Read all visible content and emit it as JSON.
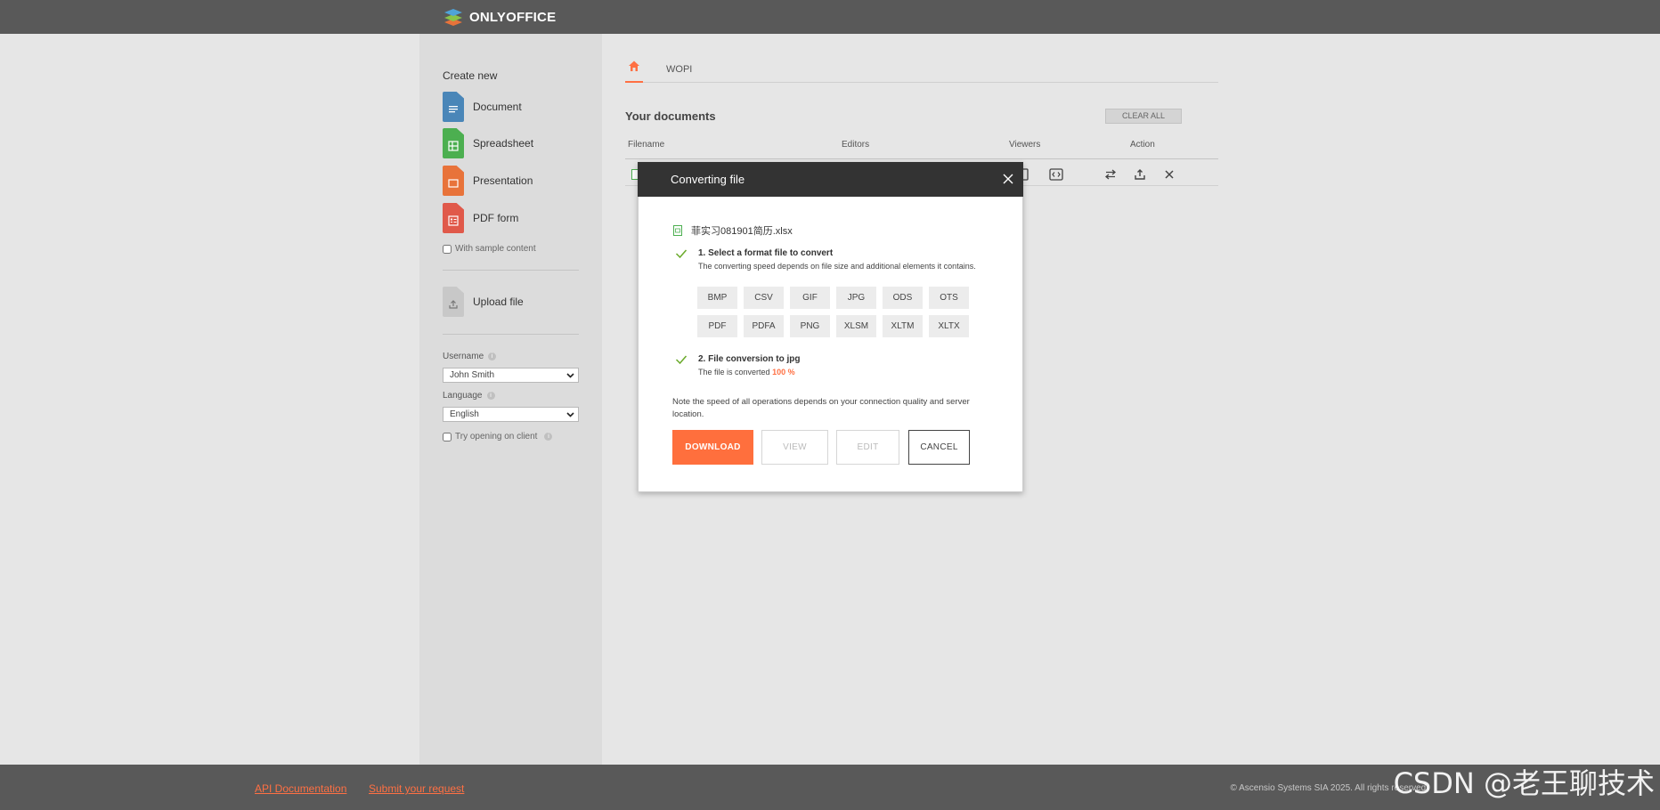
{
  "header": {
    "brand": "ONLYOFFICE"
  },
  "sidebar": {
    "create_title": "Create new",
    "create_items": [
      {
        "label": "Document",
        "color": "#4a86b8"
      },
      {
        "label": "Spreadsheet",
        "color": "#4caf50"
      },
      {
        "label": "Presentation",
        "color": "#e8733a"
      },
      {
        "label": "PDF form",
        "color": "#e0594a"
      }
    ],
    "sample_content_label": "With sample content",
    "upload_label": "Upload file",
    "username_label": "Username",
    "username_value": "John Smith",
    "language_label": "Language",
    "language_value": "English",
    "try_client_label": "Try opening on client"
  },
  "main": {
    "tab_wopi": "WOPI",
    "section_title": "Your documents",
    "clear_all": "CLEAR ALL",
    "columns": [
      "Filename",
      "Editors",
      "Viewers",
      "Action"
    ]
  },
  "modal": {
    "title": "Converting file",
    "file_name": "菲实习081901简历.xlsx",
    "step1_title": "1. Select a format file to convert",
    "step1_sub": "The converting speed depends on file size and additional elements it contains.",
    "formats": [
      "BMP",
      "CSV",
      "GIF",
      "JPG",
      "ODS",
      "OTS",
      "PDF",
      "PDFA",
      "PNG",
      "XLSM",
      "XLTM",
      "XLTX"
    ],
    "step2_title": "2. File conversion to jpg",
    "step2_sub": "The file is converted",
    "step2_percent": "100 %",
    "note": "Note the speed of all operations depends on your connection quality and server location.",
    "buttons": {
      "download": "DOWNLOAD",
      "view": "VIEW",
      "edit": "EDIT",
      "cancel": "CANCEL"
    }
  },
  "footer": {
    "api_docs": "API Documentation",
    "submit_request": "Submit your request",
    "copyright": "© Ascensio Systems SIA 2025. All rights reserved."
  },
  "watermark": "CSDN @老王聊技术",
  "colors": {
    "accent": "#ff6f3d",
    "header_bg": "#595959",
    "modal_head": "#333333"
  }
}
